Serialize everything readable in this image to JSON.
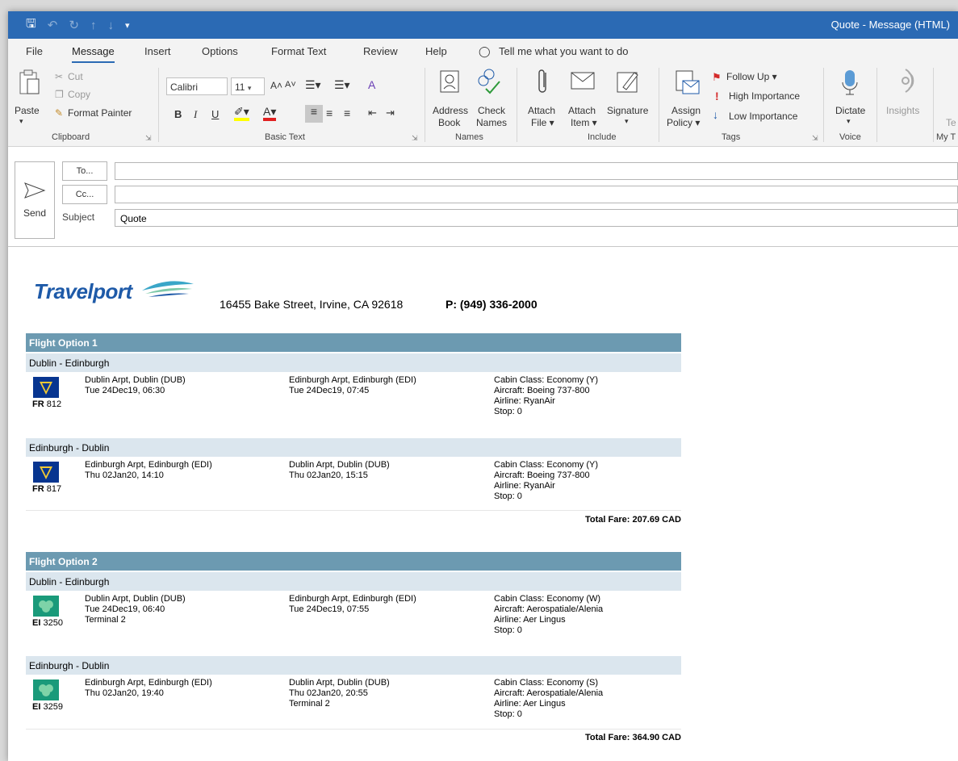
{
  "window": {
    "title": "Quote  -  Message (HTML)"
  },
  "menu": [
    "File",
    "Message",
    "Insert",
    "Options",
    "Format Text",
    "Review",
    "Help",
    "Tell me what you want to do"
  ],
  "ribbon": {
    "clipboard": {
      "paste": "Paste",
      "cut": "Cut",
      "copy": "Copy",
      "format_painter": "Format Painter",
      "group": "Clipboard"
    },
    "basic_text": {
      "font": "Calibri",
      "size": "11",
      "bold": "B",
      "italic": "I",
      "underline": "U",
      "group": "Basic Text"
    },
    "names": {
      "address_book_1": "Address",
      "address_book_2": "Book",
      "check_names_1": "Check",
      "check_names_2": "Names",
      "group": "Names"
    },
    "include": {
      "attach_file_1": "Attach",
      "attach_file_2": "File ▾",
      "attach_item_1": "Attach",
      "attach_item_2": "Item ▾",
      "signature": "Signature",
      "group": "Include"
    },
    "tags": {
      "assign_1": "Assign",
      "assign_2": "Policy ▾",
      "follow_up": "Follow Up ▾",
      "high": "High Importance",
      "low": "Low Importance",
      "group": "Tags"
    },
    "voice": {
      "dictate": "Dictate",
      "group": "Voice"
    },
    "insights": {
      "label": "Insights"
    },
    "mytemplates": {
      "group": "My T",
      "te": "Te"
    }
  },
  "compose": {
    "send": "Send",
    "to": "To...",
    "cc": "Cc...",
    "subject_label": "Subject",
    "to_value": "",
    "cc_value": "",
    "subject_value": "Quote"
  },
  "email": {
    "brand": "Travelport",
    "address": "16455 Bake Street, Irvine, CA 92618",
    "phone": "P: (949) 336-2000",
    "options": [
      {
        "title": "Flight Option 1",
        "total": "Total Fare: 207.69 CAD",
        "legs": [
          {
            "route": "Dublin - Edinburgh",
            "airline_code": "FR",
            "flight": "812",
            "logo": "ryanair-logo",
            "dep_name": "Dublin Arpt, Dublin (DUB)",
            "dep_time": "Tue 24Dec19, 06:30",
            "dep_term": "",
            "arr_name": "Edinburgh Arpt, Edinburgh (EDI)",
            "arr_time": "Tue 24Dec19, 07:45",
            "arr_term": "",
            "cabin": "Cabin Class: Economy (Y)",
            "aircraft": "Aircraft: Boeing 737-800",
            "airline": "Airline: RyanAir",
            "stop": "Stop: 0"
          },
          {
            "route": "Edinburgh - Dublin",
            "airline_code": "FR",
            "flight": "817",
            "logo": "ryanair-logo",
            "dep_name": "Edinburgh Arpt, Edinburgh (EDI)",
            "dep_time": "Thu 02Jan20, 14:10",
            "dep_term": "",
            "arr_name": "Dublin Arpt, Dublin (DUB)",
            "arr_time": "Thu 02Jan20, 15:15",
            "arr_term": "",
            "cabin": "Cabin Class: Economy (Y)",
            "aircraft": "Aircraft: Boeing 737-800",
            "airline": "Airline: RyanAir",
            "stop": "Stop: 0"
          }
        ]
      },
      {
        "title": "Flight Option 2",
        "total": "Total Fare: 364.90 CAD",
        "legs": [
          {
            "route": "Dublin - Edinburgh",
            "airline_code": "EI",
            "flight": "3250",
            "logo": "aer-lingus-logo",
            "dep_name": "Dublin Arpt, Dublin (DUB)",
            "dep_time": "Tue 24Dec19, 06:40",
            "dep_term": "Terminal 2",
            "arr_name": "Edinburgh Arpt, Edinburgh (EDI)",
            "arr_time": "Tue 24Dec19, 07:55",
            "arr_term": "",
            "cabin": "Cabin Class: Economy (W)",
            "aircraft": "Aircraft: Aerospatiale/Alenia",
            "airline": "Airline: Aer Lingus",
            "stop": "Stop: 0"
          },
          {
            "route": "Edinburgh - Dublin",
            "airline_code": "EI",
            "flight": "3259",
            "logo": "aer-lingus-logo",
            "dep_name": "Edinburgh Arpt, Edinburgh (EDI)",
            "dep_time": "Thu 02Jan20, 19:40",
            "dep_term": "",
            "arr_name": "Dublin Arpt, Dublin (DUB)",
            "arr_time": "Thu 02Jan20, 20:55",
            "arr_term": "Terminal 2",
            "cabin": "Cabin Class: Economy (S)",
            "aircraft": "Aircraft: Aerospatiale/Alenia",
            "airline": "Airline: Aer Lingus",
            "stop": "Stop: 0"
          }
        ]
      }
    ]
  },
  "colors": {
    "titlebar": "#2b6ab4",
    "option_bar": "#6c9ab1",
    "route_bar": "#dbe6ee",
    "brand": "#1e5aa8"
  }
}
